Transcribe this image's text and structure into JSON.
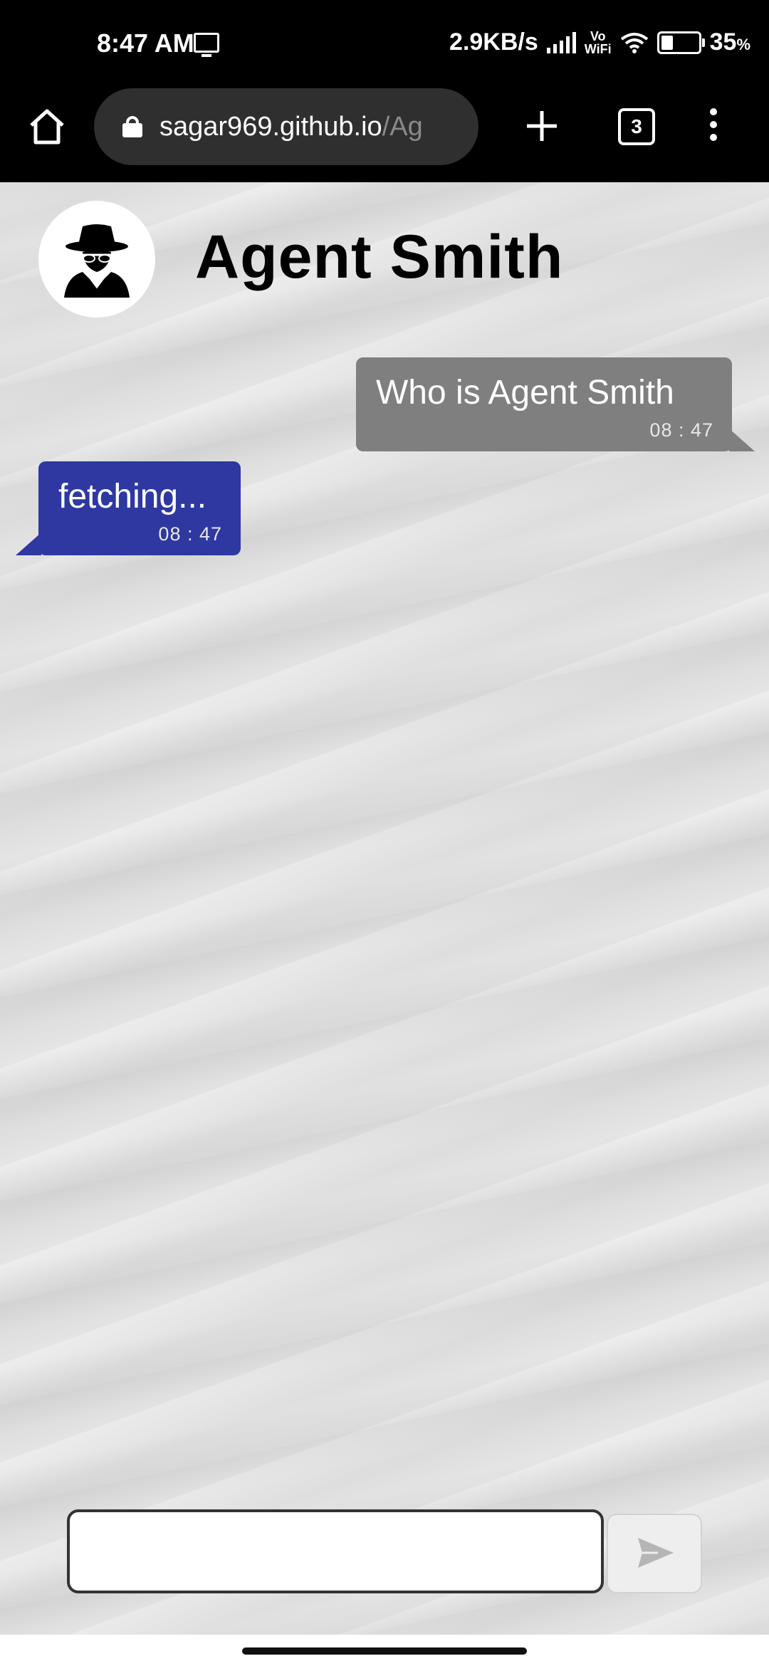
{
  "status_bar": {
    "time": "8:47 AM",
    "net_speed": "2.9KB/s",
    "vowifi_top": "Vo",
    "vowifi_bottom": "WiFi",
    "battery_pct": "35",
    "battery_unit": "%"
  },
  "browser": {
    "url_host": "sagar969.github.io",
    "url_path": "/Ag",
    "tab_count": "3"
  },
  "chat": {
    "bot_name": "Agent Smith",
    "messages": [
      {
        "from": "user",
        "text": "Who is Agent Smith",
        "time": "08 : 47"
      },
      {
        "from": "bot",
        "text": "fetching...",
        "time": "08 : 47"
      }
    ],
    "input_value": "",
    "send_color": "#b5b5b5",
    "user_bubble_color": "#7f7f7f",
    "bot_bubble_color": "#2e38a0"
  }
}
